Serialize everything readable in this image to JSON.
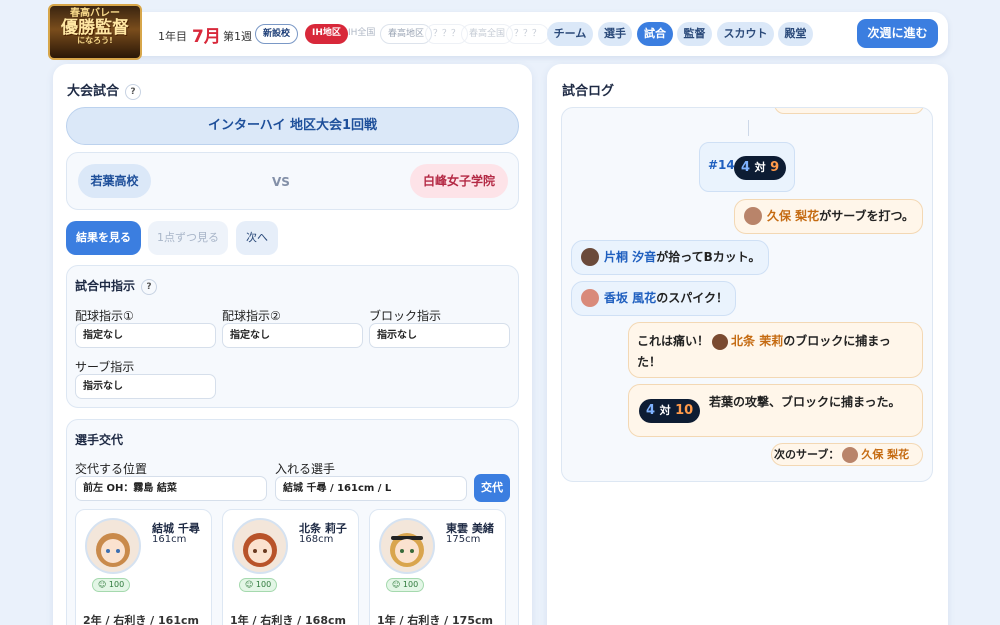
{
  "header": {
    "logo": {
      "line1": "春高バレー",
      "line2": "優勝監督",
      "line3": "になろう!"
    },
    "year": "1年目",
    "month": "7月",
    "week": "第1週",
    "badges": [
      "新設校",
      "IH地区",
      "IH全国",
      "春高地区",
      "？？？",
      "春高全国",
      "？？？"
    ],
    "nav": [
      "チーム",
      "選手",
      "試合",
      "監督",
      "スカウト",
      "殿堂"
    ],
    "active_nav": "試合",
    "next_week": "次週に進む"
  },
  "match": {
    "title": "大会試合",
    "help": "?",
    "tournament": "インターハイ 地区大会1回戦",
    "home": "若葉高校",
    "vs": "VS",
    "away": "白峰女子学院",
    "buttons": {
      "result": "結果を見る",
      "step": "1点ずつ見る",
      "next": "次へ"
    },
    "instructions": {
      "title": "試合中指示",
      "fields": [
        {
          "label": "配球指示①",
          "value": "指定なし"
        },
        {
          "label": "配球指示②",
          "value": "指定なし"
        },
        {
          "label": "ブロック指示",
          "value": "指示なし"
        },
        {
          "label": "サーブ指示",
          "value": "指示なし"
        }
      ]
    },
    "substitution": {
      "title": "選手交代",
      "position_label": "交代する位置",
      "position_value": "前左 OH：霧島 結菜",
      "player_label": "入れる選手",
      "player_value": "結城 千尋 / 161cm / L",
      "button": "交代"
    },
    "players": [
      {
        "name": "結城 千尋",
        "height": "161cm",
        "stamina": "100",
        "info": "2年 / 右利き / 161cm"
      },
      {
        "name": "北条 莉子",
        "height": "168cm",
        "stamina": "100",
        "info": "1年 / 右利き / 168cm"
      },
      {
        "name": "東雲 美緒",
        "height": "175cm",
        "stamina": "100",
        "info": "1年 / 右利き / 175cm"
      }
    ]
  },
  "log": {
    "title": "試合ログ",
    "rally": {
      "label": "#14",
      "home": "4",
      "sep": "対",
      "away": "9"
    },
    "entries": [
      {
        "name": "久保 梨花",
        "text": "がサーブを打つ。"
      },
      {
        "name": "片桐 汐音",
        "text": "が拾ってBカット。"
      },
      {
        "name": "香坂 風花",
        "text": "のスパイク！"
      },
      {
        "prefix": "これは痛い！",
        "name": "北条 茉莉",
        "text": "のブロックに捕まった！"
      }
    ],
    "score2": {
      "home": "4",
      "sep": "対",
      "away": "10",
      "text": "若葉の攻撃、ブロックに捕まった。"
    },
    "next_serve": {
      "label": "次のサーブ：",
      "name": "久保 梨花"
    }
  },
  "colors": {
    "accent": "#3b7ee0",
    "home_team": "#dbe8f8",
    "away_team": "#fde3e8",
    "score_bg": "#0d1c33",
    "name_orange": "#c56b12"
  }
}
